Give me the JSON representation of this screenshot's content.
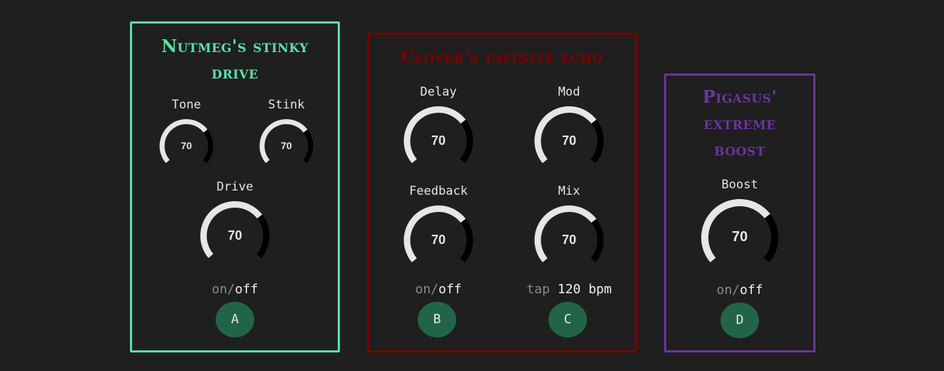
{
  "colors": {
    "background": "#1f1f1f",
    "pedal_a": "#54e3a9",
    "pedal_b": "#7d0000",
    "pedal_c": "#6d34a0",
    "knob_track": "#000000",
    "knob_fill": "#e6e6e6",
    "footswitch": "#22644a"
  },
  "pedals": [
    {
      "title": "Nutmeg's stinky drive",
      "knobs": [
        {
          "label": "Tone",
          "value": "70",
          "level": 70
        },
        {
          "label": "Stink",
          "value": "70",
          "level": 70
        },
        {
          "label": "Drive",
          "value": "70",
          "level": 70
        }
      ],
      "switches": [
        {
          "label_on": "on/",
          "label_off": "off",
          "key": "A"
        }
      ]
    },
    {
      "title": "Clover's infinite echo",
      "knobs": [
        {
          "label": "Delay",
          "value": "70",
          "level": 70
        },
        {
          "label": "Mod",
          "value": "70",
          "level": 70
        },
        {
          "label": "Feedback",
          "value": "70",
          "level": 70
        },
        {
          "label": "Mix",
          "value": "70",
          "level": 70
        }
      ],
      "switches": [
        {
          "label_on": "on/",
          "label_off": "off",
          "key": "B"
        },
        {
          "label_on": "tap ",
          "label_off": "120 bpm",
          "key": "C"
        }
      ]
    },
    {
      "title": "Pigasus' extreme boost",
      "knobs": [
        {
          "label": "Boost",
          "value": "70",
          "level": 70
        }
      ],
      "switches": [
        {
          "label_on": "on/",
          "label_off": "off",
          "key": "D"
        }
      ]
    }
  ]
}
